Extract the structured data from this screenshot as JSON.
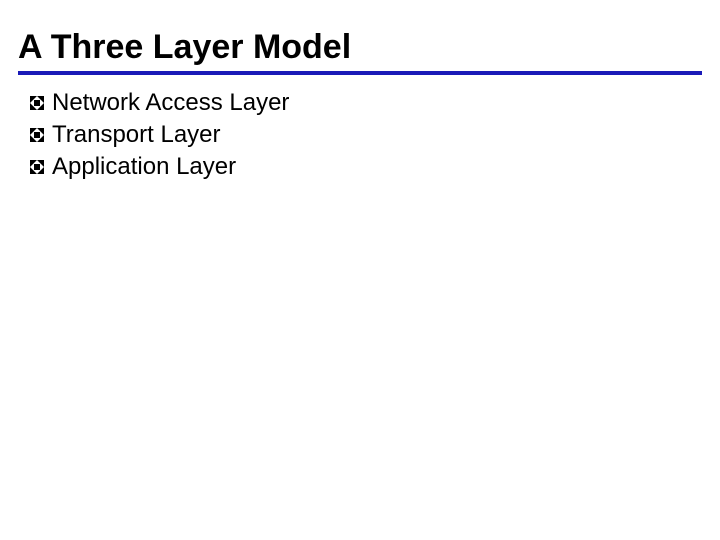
{
  "title": "A Three Layer Model",
  "bullets": {
    "item0": "Network Access Layer",
    "item1": "Transport Layer",
    "item2": "Application Layer"
  }
}
